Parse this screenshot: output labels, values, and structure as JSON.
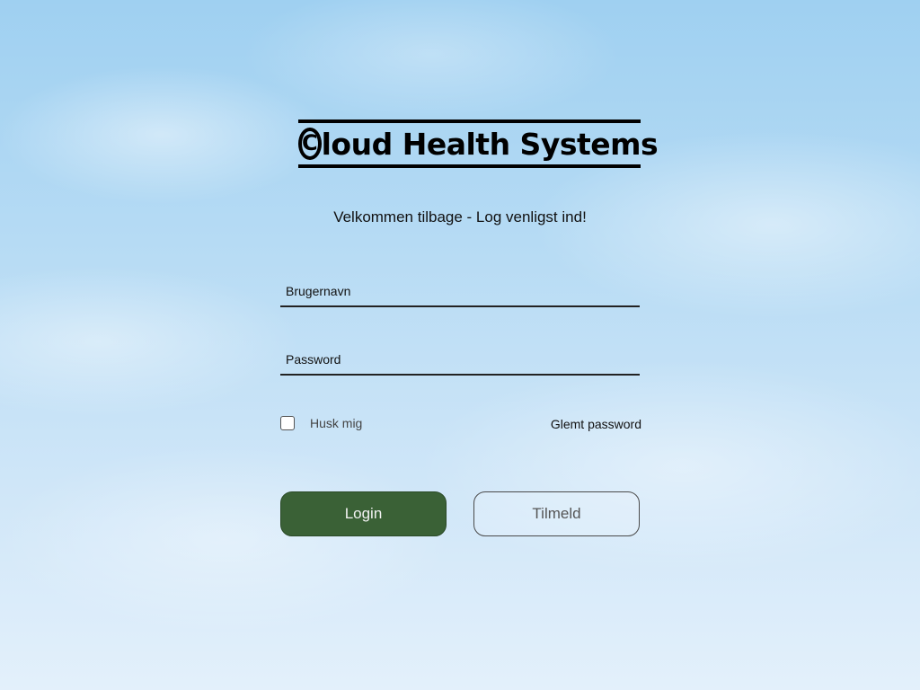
{
  "brand": {
    "logo_letter": "C",
    "name_rest": "loud Health Systems"
  },
  "welcome_text": "Velkommen tilbage - Log venligst ind!",
  "form": {
    "username_placeholder": "Brugernavn",
    "password_placeholder": "Password",
    "remember_label": "Husk mig",
    "forgot_label": "Glemt password",
    "login_label": "Login",
    "signup_label": "Tilmeld"
  },
  "colors": {
    "login_button": "#3a6136",
    "text": "#111111"
  }
}
